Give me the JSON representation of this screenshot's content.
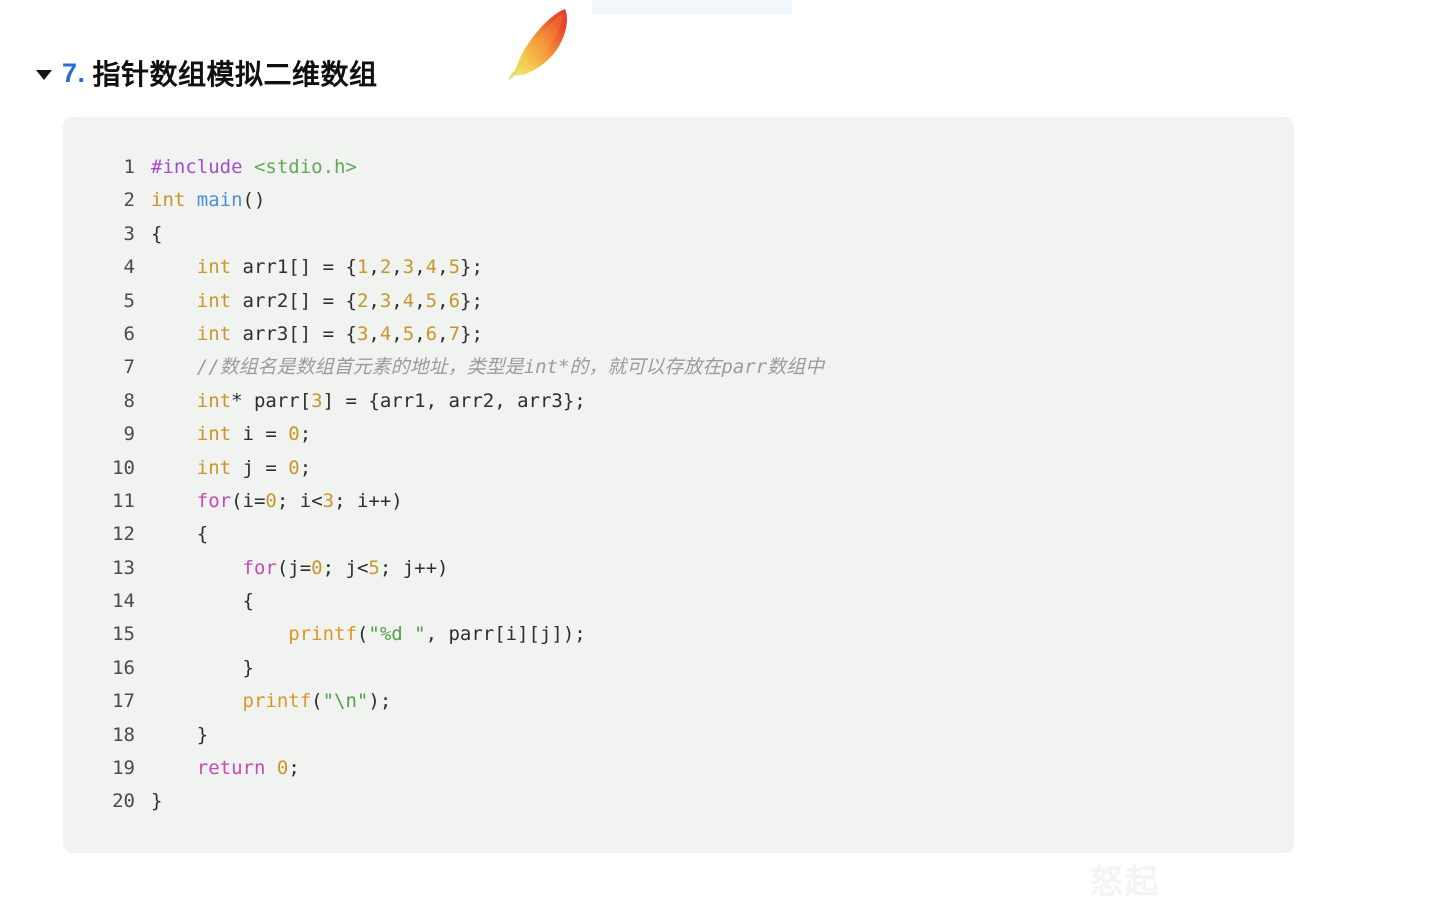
{
  "document": {
    "heading": {
      "collapse_icon": "triangle-down-icon",
      "number": "7.",
      "title": "指针数组模拟二维数组",
      "number_color": "#2b6cd4",
      "title_color": "#101010"
    },
    "decorations": {
      "feather_icon": "feather-icon",
      "feather_colors": [
        "#e8412f",
        "#f2682a",
        "#f5a623",
        "#d9d42a"
      ],
      "top_band_color": "#f2f7fc"
    },
    "watermark": "怒起",
    "code_block": {
      "background": "#f1f3f0",
      "language": "c",
      "gutter_color": "#4a4a4a",
      "text_color": "#2e2e2e",
      "token_colors": {
        "preprocessor": "#a64ccc",
        "include_path": "#62a85c",
        "type": "#c8962a",
        "function_def": "#4a90d9",
        "number": "#c8962a",
        "keyword": "#c44ab5",
        "call": "#d79a28",
        "string": "#579b4e",
        "comment": "#9b9b9b"
      },
      "lines": [
        {
          "n": "1",
          "text": "#include <stdio.h>"
        },
        {
          "n": "2",
          "text": "int main()"
        },
        {
          "n": "3",
          "text": "{"
        },
        {
          "n": "4",
          "text": "    int arr1[] = {1,2,3,4,5};"
        },
        {
          "n": "5",
          "text": "    int arr2[] = {2,3,4,5,6};"
        },
        {
          "n": "6",
          "text": "    int arr3[] = {3,4,5,6,7};"
        },
        {
          "n": "7",
          "text": "    //数组名是数组首元素的地址，类型是int*的，就可以存放在parr数组中"
        },
        {
          "n": "8",
          "text": "    int* parr[3] = {arr1, arr2, arr3};"
        },
        {
          "n": "9",
          "text": "    int i = 0;"
        },
        {
          "n": "10",
          "text": "    int j = 0;"
        },
        {
          "n": "11",
          "text": "    for(i=0; i<3; i++)"
        },
        {
          "n": "12",
          "text": "    {"
        },
        {
          "n": "13",
          "text": "        for(j=0; j<5; j++)"
        },
        {
          "n": "14",
          "text": "        {"
        },
        {
          "n": "15",
          "text": "            printf(\"%d \", parr[i][j]);"
        },
        {
          "n": "16",
          "text": "        }"
        },
        {
          "n": "17",
          "text": "        printf(\"\\n\");"
        },
        {
          "n": "18",
          "text": "    }"
        },
        {
          "n": "19",
          "text": "    return 0;"
        },
        {
          "n": "20",
          "text": "}"
        }
      ]
    }
  }
}
